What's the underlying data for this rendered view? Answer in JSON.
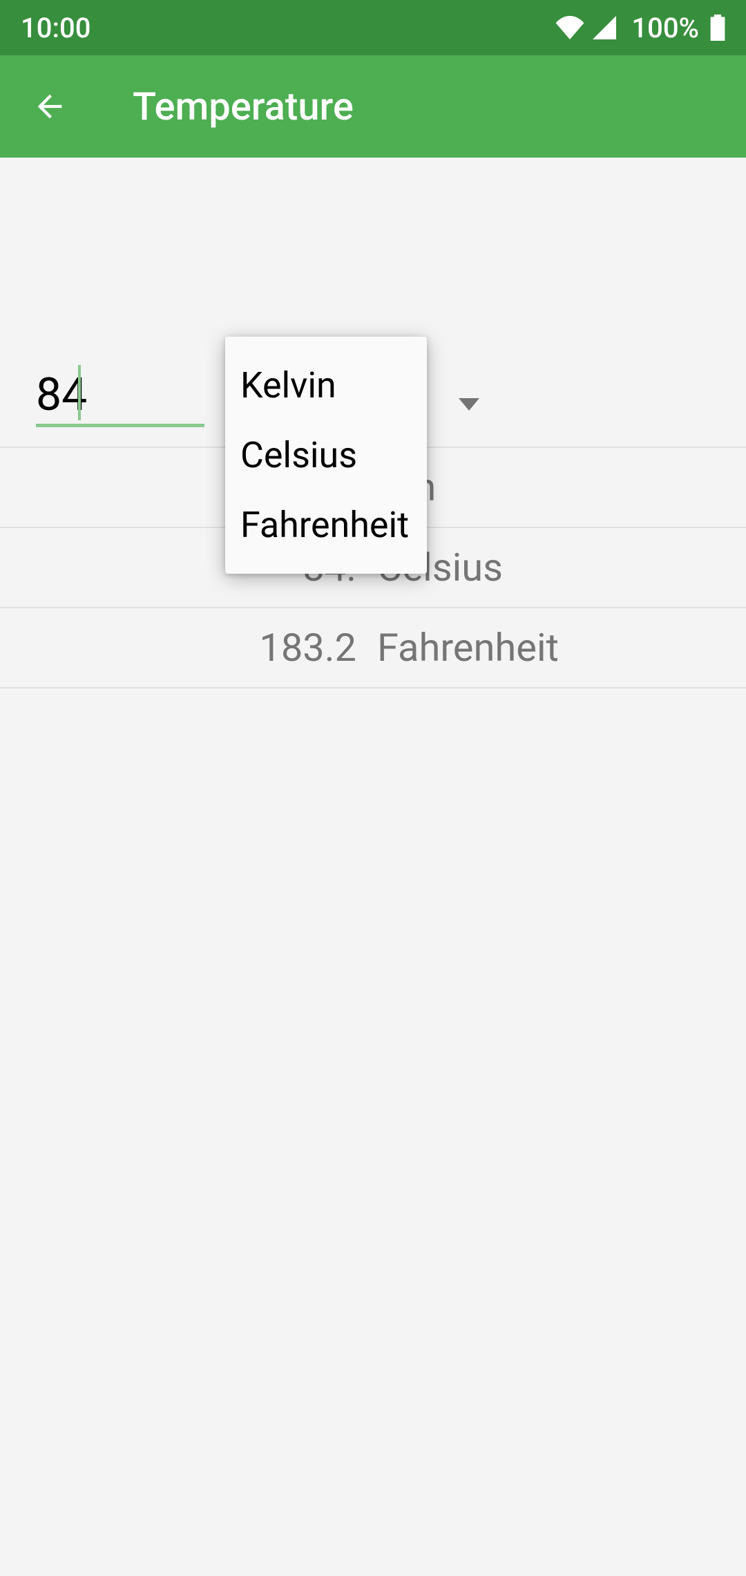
{
  "status": {
    "time": "10:00",
    "battery_pct": "100%"
  },
  "header": {
    "title": "Temperature"
  },
  "input": {
    "value": "84"
  },
  "dropdown": {
    "options": [
      "Kelvin",
      "Celsius",
      "Fahrenheit"
    ]
  },
  "results": [
    {
      "value": "",
      "unit_partial": "lvin",
      "unit": "Kelvin"
    },
    {
      "value": "84.",
      "unit": "Celsius"
    },
    {
      "value": "183.2",
      "unit": "Fahrenheit"
    }
  ]
}
